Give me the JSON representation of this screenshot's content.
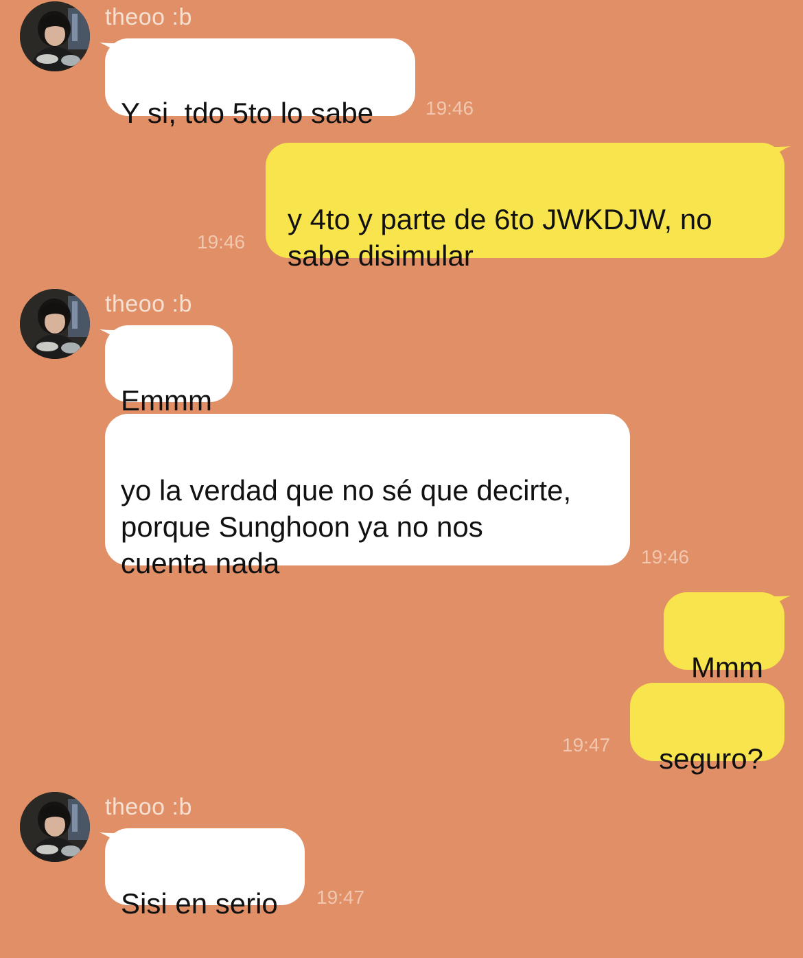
{
  "contact": {
    "name": "theoo :b"
  },
  "colors": {
    "background": "#e08f66",
    "incoming_bubble": "#ffffff",
    "outgoing_bubble": "#f8e44c",
    "timestamp": "#f1c7b0",
    "sender_name": "#f5e1d4"
  },
  "messages": [
    {
      "direction": "in",
      "text": "Y si, tdo 5to lo sabe",
      "time": "19:46"
    },
    {
      "direction": "out",
      "text": "y 4to y parte de 6to JWKDJW, no\nsabe disimular",
      "time": "19:46"
    },
    {
      "direction": "in",
      "text": "Emmm",
      "time": ""
    },
    {
      "direction": "in",
      "text": "yo la verdad que no sé que decirte,\nporque Sunghoon ya no nos\ncuenta nada",
      "time": "19:46"
    },
    {
      "direction": "out",
      "text": "Mmm",
      "time": ""
    },
    {
      "direction": "out",
      "text": "seguro?",
      "time": "19:47"
    },
    {
      "direction": "in",
      "text": "Sisi en serio",
      "time": "19:47"
    }
  ]
}
